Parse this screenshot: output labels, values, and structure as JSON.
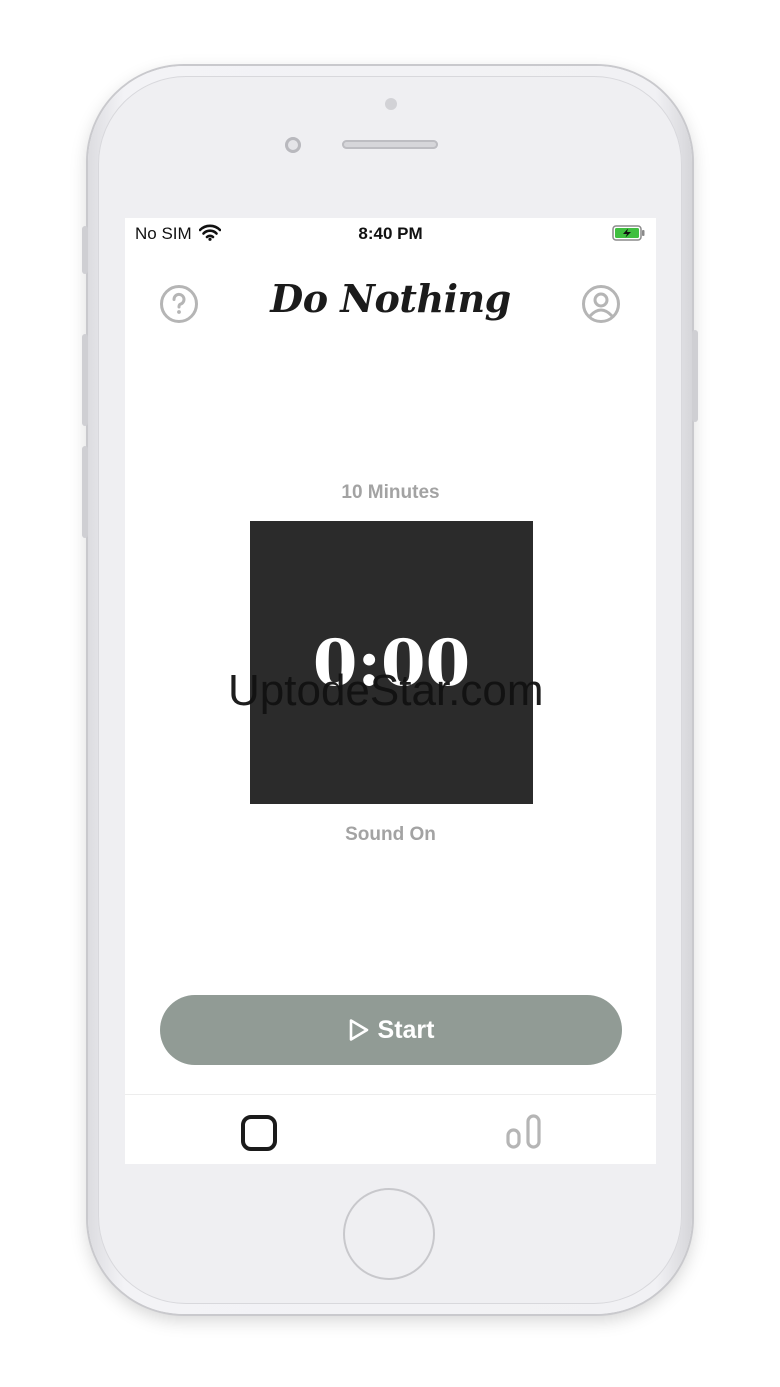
{
  "status_bar": {
    "carrier": "No SIM",
    "time": "8:40 PM",
    "wifi_icon": "wifi-icon",
    "battery_icon": "battery-charging-icon"
  },
  "header": {
    "title": "Do Nothing",
    "help_icon": "help-circle-icon",
    "profile_icon": "user-profile-icon"
  },
  "timer": {
    "duration_label": "10 Minutes",
    "display": "0:00",
    "sound_label": "Sound On"
  },
  "watermark": "UptodeStar.com",
  "start_button": {
    "label": "Start",
    "icon": "play-icon"
  },
  "tab_bar": {
    "items": [
      {
        "name": "timer",
        "icon": "square-icon",
        "active": true
      },
      {
        "name": "stats",
        "icon": "bar-chart-icon",
        "active": false
      }
    ]
  },
  "colors": {
    "accent": "#919b95",
    "timer_bg": "#2b2b2b",
    "muted_text": "#a3a3a3",
    "battery": "#3fbf3f"
  }
}
